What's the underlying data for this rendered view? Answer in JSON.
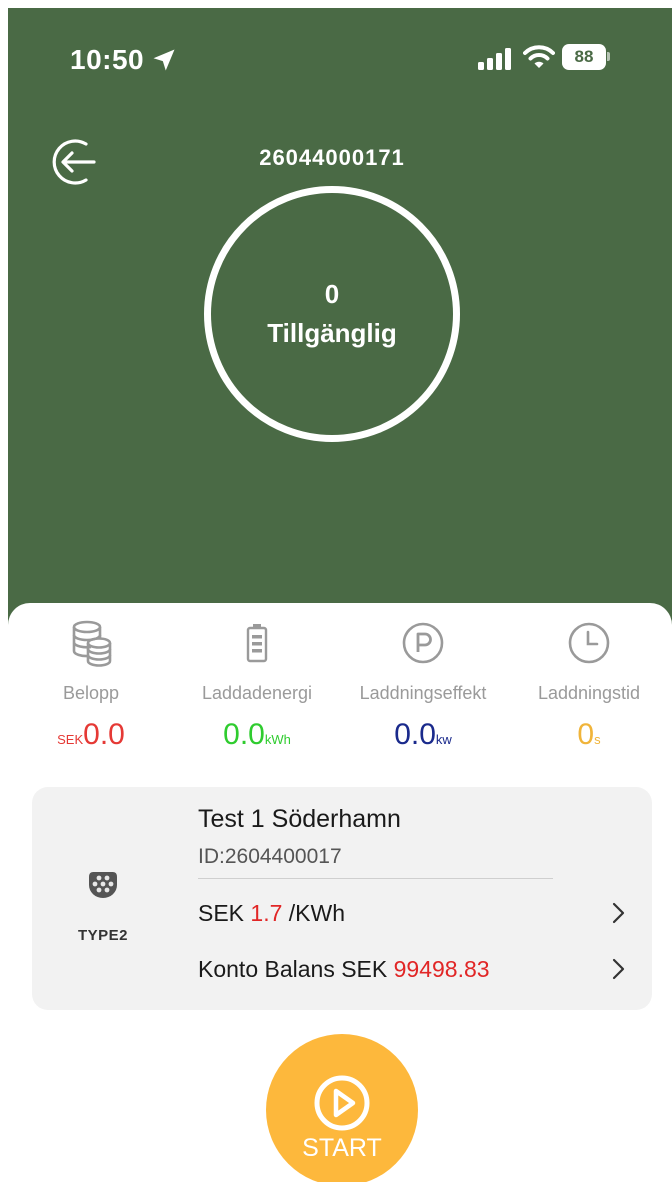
{
  "status_bar": {
    "time": "10:50",
    "battery": "88"
  },
  "header": {
    "station_id": "26044000171"
  },
  "connector_status": {
    "count": "0",
    "state": "Tillgänglig"
  },
  "stats": [
    {
      "label": "Belopp",
      "prefix": "SEK",
      "value": "0.0",
      "unit": "",
      "color": "#e53935",
      "icon": "coins-icon"
    },
    {
      "label": "Laddadenergi",
      "prefix": "",
      "value": "0.0",
      "unit": "kWh",
      "color": "#2fcc2f",
      "icon": "battery-icon"
    },
    {
      "label": "Laddningseffekt",
      "prefix": "",
      "value": "0.0",
      "unit": "kw",
      "color": "#1a2a8c",
      "icon": "parking-icon"
    },
    {
      "label": "Laddningstid",
      "prefix": "",
      "value": "0",
      "unit": "s",
      "color": "#f0b43a",
      "icon": "clock-icon"
    }
  ],
  "station": {
    "connector_type": "TYPE2",
    "name": "Test 1 Söderhamn",
    "id_text": "ID:2604400017",
    "price_prefix": "SEK",
    "price_value": "1.7",
    "price_suffix": "/KWh",
    "balance_prefix": "Konto Balans SEK",
    "balance_value": "99498.83"
  },
  "start_button": {
    "label": "START"
  },
  "colors": {
    "header_bg": "#4a6a45",
    "start_bg": "#fdb83c",
    "accent_red": "#e12626"
  }
}
